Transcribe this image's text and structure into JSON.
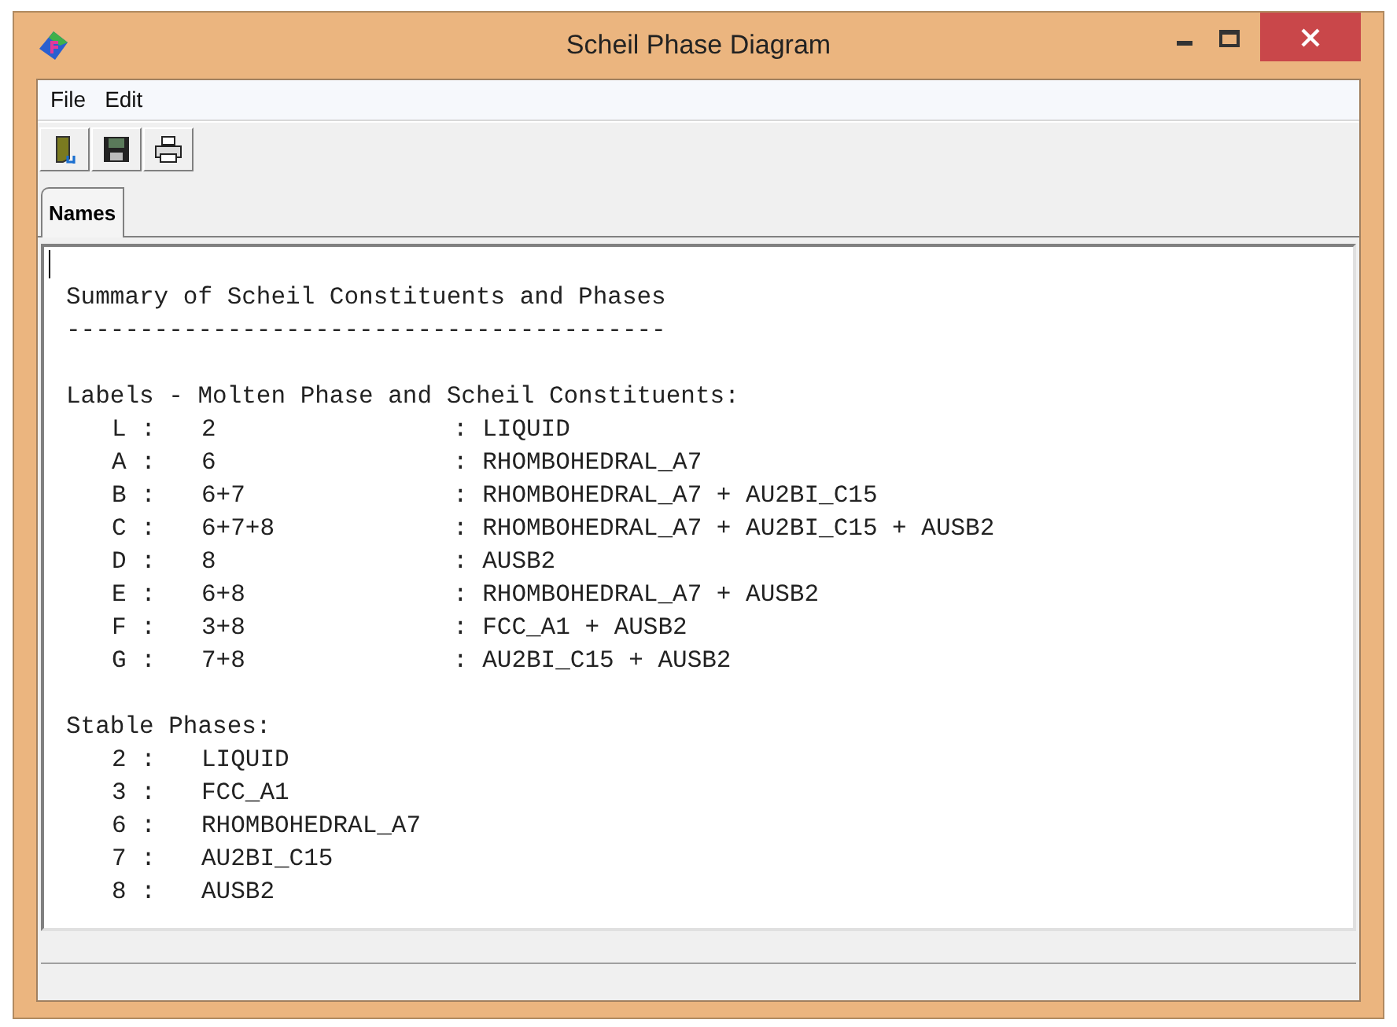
{
  "window": {
    "title": "Scheil Phase Diagram"
  },
  "menu": [
    "File",
    "Edit"
  ],
  "tabs": [
    {
      "label": "Names",
      "selected": true
    }
  ],
  "document": {
    "title": "Summary of Scheil Constituents and Phases",
    "rule": "-----------------------------------------",
    "labels_heading": "Labels - Molten Phase and Scheil Constituents:",
    "labels": [
      {
        "label": "L :",
        "constituents": "2",
        "phases": ": LIQUID"
      },
      {
        "label": "A :",
        "constituents": "6",
        "phases": ": RHOMBOHEDRAL_A7"
      },
      {
        "label": "B :",
        "constituents": "6+7",
        "phases": ": RHOMBOHEDRAL_A7 + AU2BI_C15"
      },
      {
        "label": "C :",
        "constituents": "6+7+8",
        "phases": ": RHOMBOHEDRAL_A7 + AU2BI_C15 + AUSB2"
      },
      {
        "label": "D :",
        "constituents": "8",
        "phases": ": AUSB2"
      },
      {
        "label": "E :",
        "constituents": "6+8",
        "phases": ": RHOMBOHEDRAL_A7 + AUSB2"
      },
      {
        "label": "F :",
        "constituents": "3+8",
        "phases": ": FCC_A1 + AUSB2"
      },
      {
        "label": "G :",
        "constituents": "7+8",
        "phases": ": AU2BI_C15 + AUSB2"
      }
    ],
    "stable_heading": "Stable Phases:",
    "stable_phases": [
      {
        "number": "2 :",
        "name": "LIQUID"
      },
      {
        "number": "3 :",
        "name": "FCC_A1"
      },
      {
        "number": "6 :",
        "name": "RHOMBOHEDRAL_A7"
      },
      {
        "number": "7 :",
        "name": "AU2BI_C15"
      },
      {
        "number": "8 :",
        "name": "AUSB2"
      }
    ]
  }
}
